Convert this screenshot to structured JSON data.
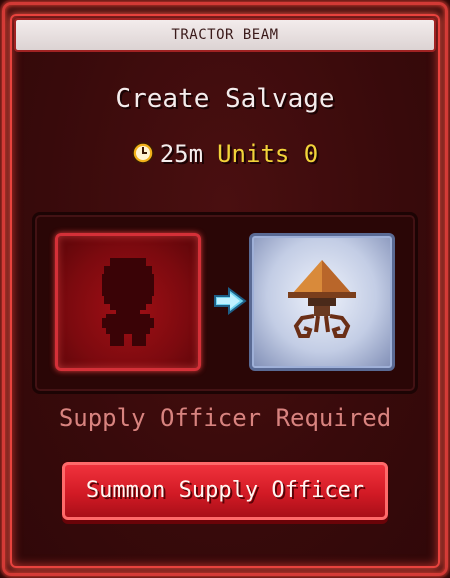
{
  "window": {
    "title": "TRACTOR BEAM"
  },
  "recipe": {
    "heading": "Create Salvage",
    "timer": "25m",
    "units_label": "Units 0",
    "input_icon": "crew-silhouette-icon",
    "output_icon": "salvage-drone-icon",
    "arrow_icon": "arrow-right-icon"
  },
  "requirement": {
    "text": "Supply Officer Required"
  },
  "actions": {
    "summon_label": "Summon Supply Officer"
  },
  "colors": {
    "accent_red": "#e8433e",
    "units_yellow": "#f2d43a",
    "requirement_text": "#d8837f"
  }
}
